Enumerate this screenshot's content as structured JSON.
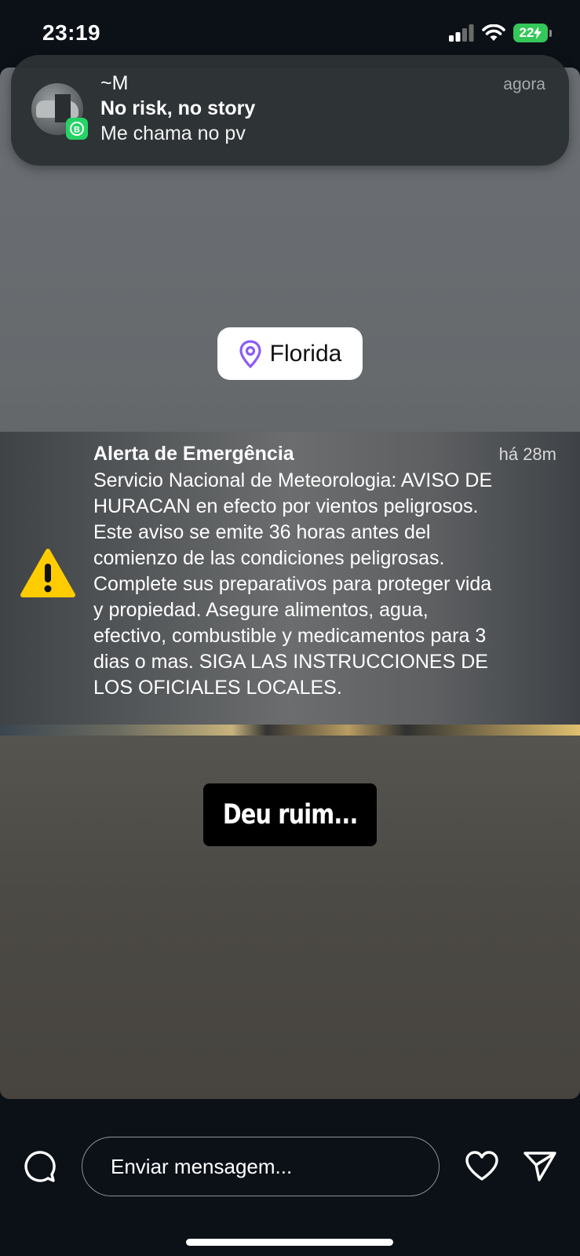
{
  "status_bar": {
    "time": "23:19",
    "battery": "22",
    "icons": [
      "cellular-signal-icon",
      "wifi-icon",
      "battery-charging-icon"
    ]
  },
  "notification": {
    "app": "WhatsApp Business",
    "sender": "~M",
    "title": "No risk, no story",
    "body": "Me chama no pv",
    "time": "agora"
  },
  "story": {
    "location_sticker": "Florida",
    "text_sticker": "Deu ruim...",
    "alert": {
      "title": "Alerta de Emergência",
      "time": "há 28m",
      "body": "Servicio Nacional de Meteorologia: AVISO DE\nHURACAN en efecto por vientos peligrosos.\nEste aviso se emite 36 horas antes del\ncomienzo de las condiciones peligrosas.\nComplete sus preparativos para proteger vida\ny propiedad. Asegure alimentos, agua,\nefectivo, combustible y medicamentos para 3\ndias o mas. SIGA LAS INSTRUCCIONES DE\nLOS OFICIALES LOCALES."
    }
  },
  "reply_bar": {
    "placeholder": "Enviar mensagem..."
  },
  "colors": {
    "whatsapp_green": "#25d366",
    "battery_green": "#34c759",
    "location_pin": "#8b5cf6",
    "warning_yellow": "#ffcc00"
  }
}
